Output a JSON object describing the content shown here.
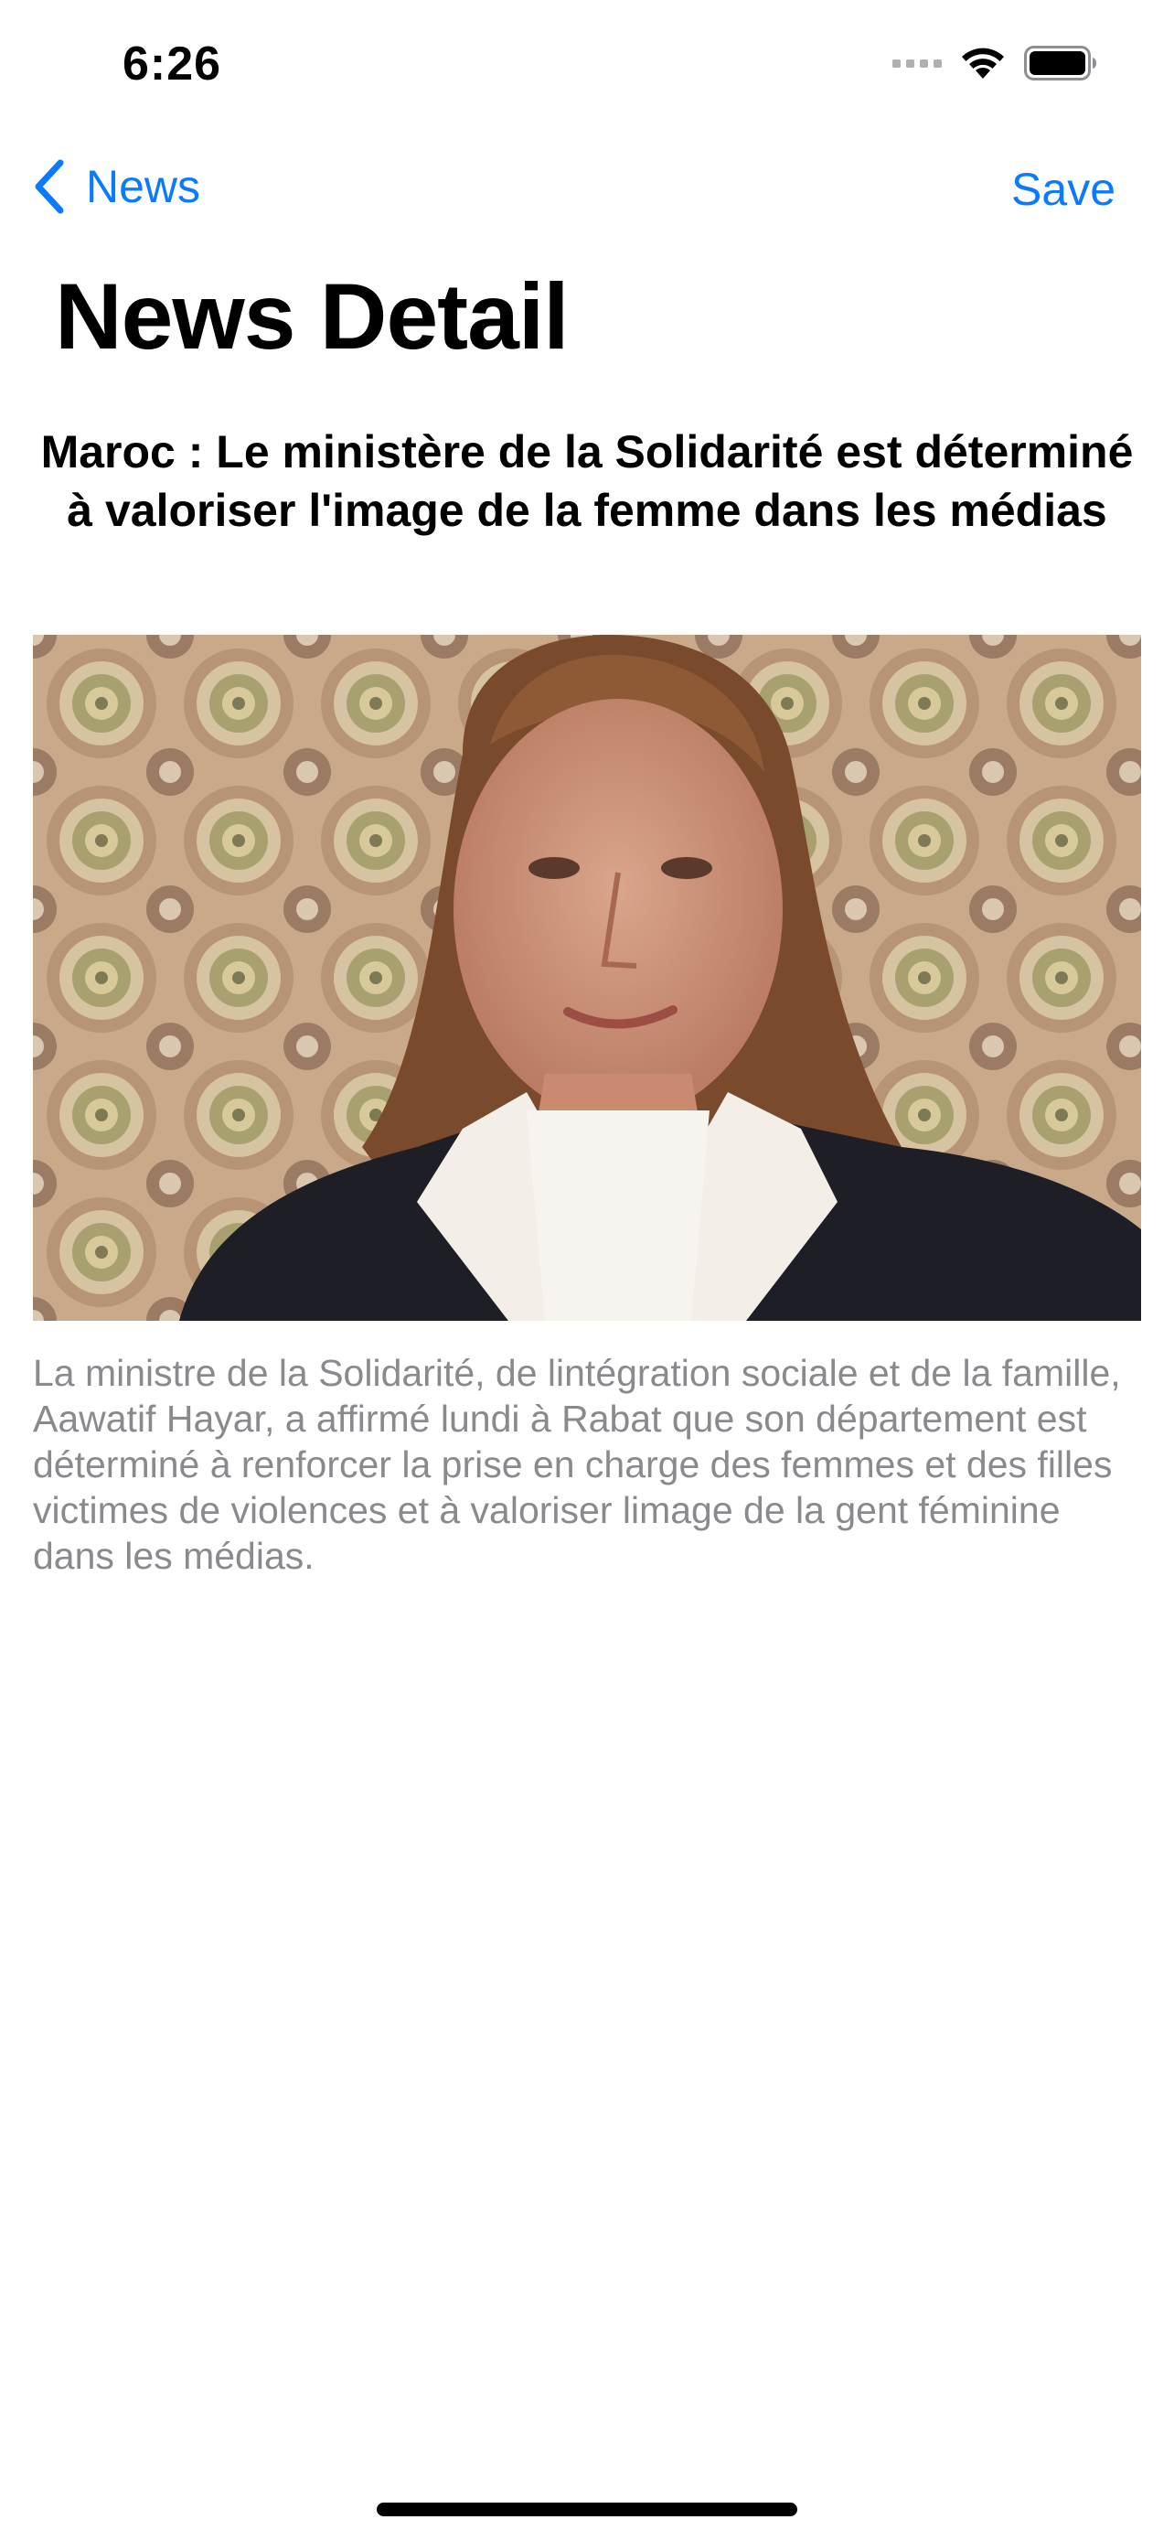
{
  "status_bar": {
    "time": "6:26"
  },
  "nav": {
    "back_label": "News",
    "save_label": "Save",
    "accent_color": "#0a7aff"
  },
  "page": {
    "title": "News Detail"
  },
  "article": {
    "title": "Maroc : Le ministère de la Solidarité est déterminé à valoriser l'image de la femme dans les médias",
    "body": "La ministre de la Solidarité, de lintégration sociale et de la famille, Aawatif Hayar, a affirmé lundi à Rabat que son département est déterminé à renforcer la prise en charge des femmes et des filles victimes de violences et à valoriser limage de la gent féminine dans les médias."
  },
  "icons": {
    "back": "chevron-left-icon",
    "signal": "cellular-signal-icon",
    "wifi": "wifi-icon",
    "battery": "battery-icon"
  }
}
